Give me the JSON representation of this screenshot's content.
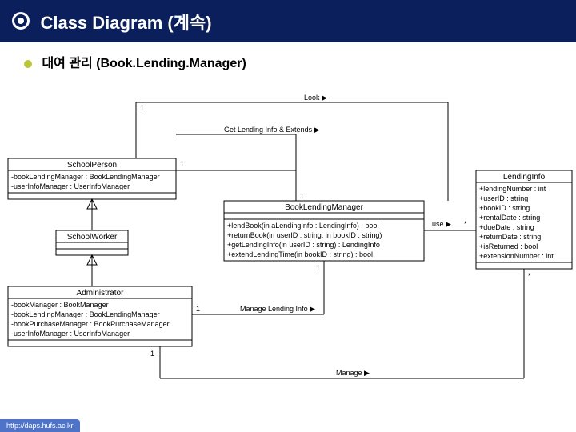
{
  "header": {
    "title": "Class Diagram (계속)"
  },
  "sub": {
    "title": "대여 관리 (Book.Lending.Manager)"
  },
  "footer": {
    "url": "http://daps.hufs.ac.kr"
  },
  "classes": {
    "schoolPerson": {
      "name": "SchoolPerson",
      "attrs": [
        "-bookLendingManager : BookLendingManager",
        "-userInfoManager : UserInfoManager"
      ]
    },
    "schoolWorker": {
      "name": "SchoolWorker"
    },
    "administrator": {
      "name": "Administrator",
      "attrs": [
        "-bookManager : BookManager",
        "-bookLendingManager : BookLendingManager",
        "-bookPurchaseManager : BookPurchaseManager",
        "-userInfoManager : UserInfoManager"
      ]
    },
    "bookLendingManager": {
      "name": "BookLendingManager",
      "ops": [
        "+lendBook(in aLendingInfo : LendingInfo) : bool",
        "+returnBook(in userID : string, in bookID : string)",
        "+getLendingInfo(in userID : string) : LendingInfo",
        "+extendLendingTime(in bookID : string) : bool"
      ]
    },
    "lendingInfo": {
      "name": "LendingInfo",
      "attrs": [
        "+lendingNumber : int",
        "+userID : string",
        "+bookID : string",
        "+rentalDate : string",
        "+dueDate : string",
        "+returnDate : string",
        "+isReturned : bool",
        "+extensionNumber : int"
      ]
    }
  },
  "labels": {
    "look": "Look ▶",
    "getInfo": "Get Lending Info & Extends ▶",
    "use": "use ▶",
    "manageInfo": "Manage Lending Info ▶",
    "manage": "Manage ▶",
    "one": "1",
    "star": "*"
  }
}
